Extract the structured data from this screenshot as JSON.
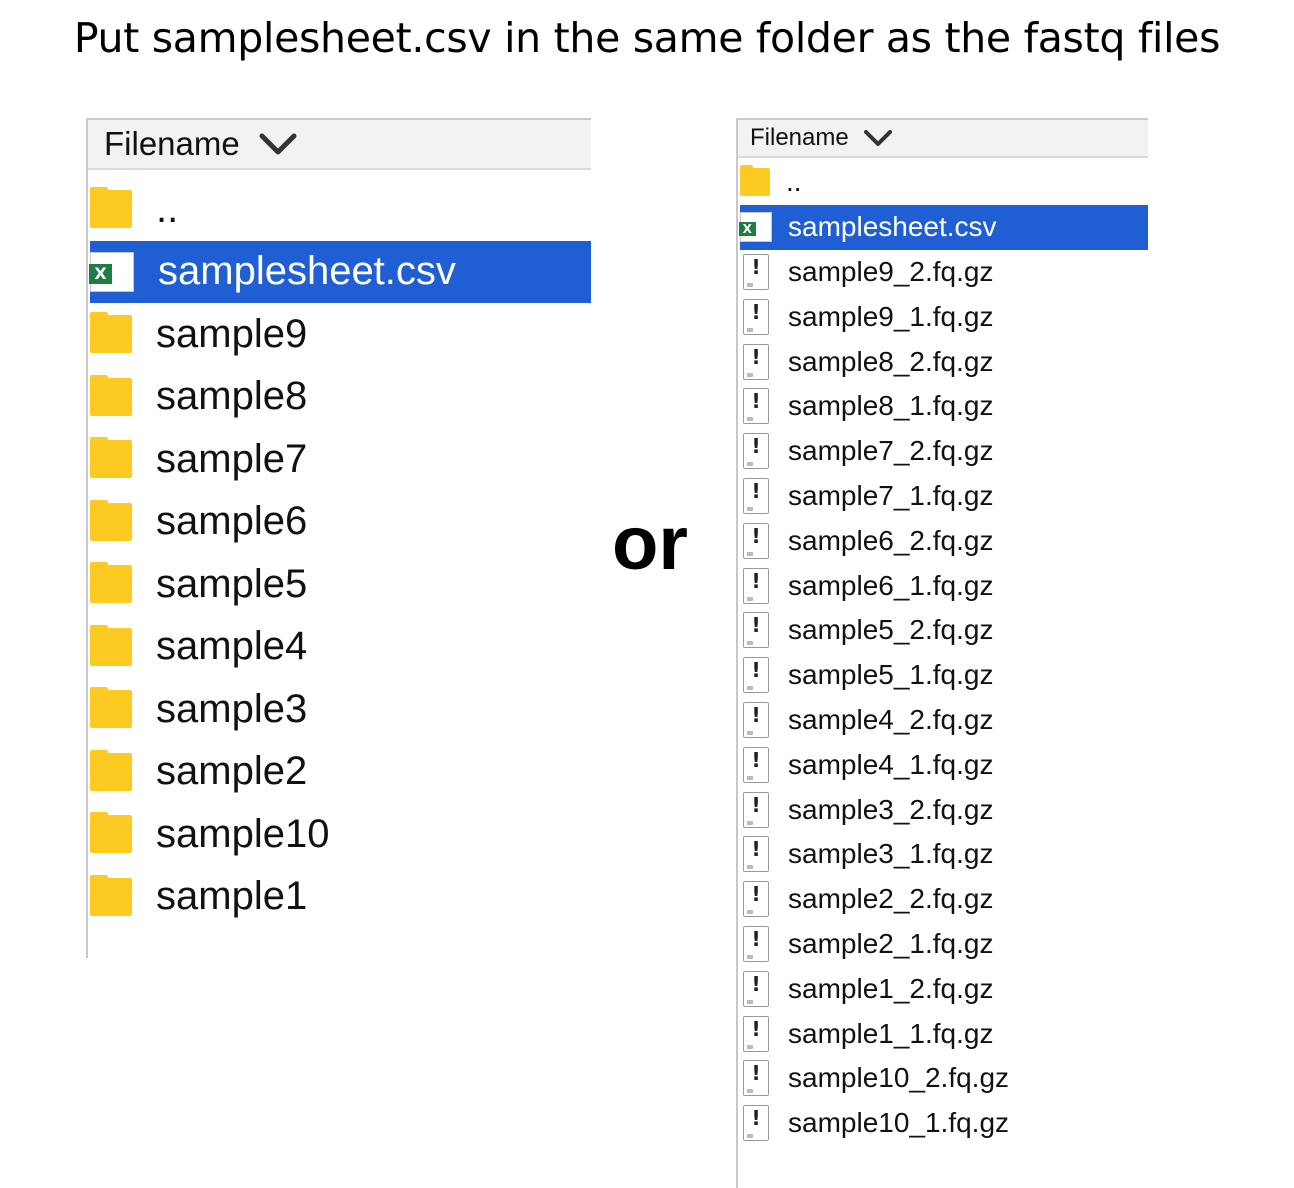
{
  "title": "Put samplesheet.csv in the same folder as the fastq files",
  "separator": "or",
  "left_panel": {
    "header_label": "Filename",
    "header_icon": "chevron-down-icon",
    "files": [
      {
        "name": "..",
        "type": "folder",
        "selected": false
      },
      {
        "name": "samplesheet.csv",
        "type": "excel-csv",
        "selected": true
      },
      {
        "name": "sample9",
        "type": "folder",
        "selected": false
      },
      {
        "name": "sample8",
        "type": "folder",
        "selected": false
      },
      {
        "name": "sample7",
        "type": "folder",
        "selected": false
      },
      {
        "name": "sample6",
        "type": "folder",
        "selected": false
      },
      {
        "name": "sample5",
        "type": "folder",
        "selected": false
      },
      {
        "name": "sample4",
        "type": "folder",
        "selected": false
      },
      {
        "name": "sample3",
        "type": "folder",
        "selected": false
      },
      {
        "name": "sample2",
        "type": "folder",
        "selected": false
      },
      {
        "name": "sample10",
        "type": "folder",
        "selected": false
      },
      {
        "name": "sample1",
        "type": "folder",
        "selected": false
      }
    ]
  },
  "right_panel": {
    "header_label": "Filename",
    "header_icon": "chevron-down-icon",
    "files": [
      {
        "name": "..",
        "type": "folder",
        "selected": false
      },
      {
        "name": "samplesheet.csv",
        "type": "excel-csv",
        "selected": true
      },
      {
        "name": "sample9_2.fq.gz",
        "type": "gz",
        "selected": false
      },
      {
        "name": "sample9_1.fq.gz",
        "type": "gz",
        "selected": false
      },
      {
        "name": "sample8_2.fq.gz",
        "type": "gz",
        "selected": false
      },
      {
        "name": "sample8_1.fq.gz",
        "type": "gz",
        "selected": false
      },
      {
        "name": "sample7_2.fq.gz",
        "type": "gz",
        "selected": false
      },
      {
        "name": "sample7_1.fq.gz",
        "type": "gz",
        "selected": false
      },
      {
        "name": "sample6_2.fq.gz",
        "type": "gz",
        "selected": false
      },
      {
        "name": "sample6_1.fq.gz",
        "type": "gz",
        "selected": false
      },
      {
        "name": "sample5_2.fq.gz",
        "type": "gz",
        "selected": false
      },
      {
        "name": "sample5_1.fq.gz",
        "type": "gz",
        "selected": false
      },
      {
        "name": "sample4_2.fq.gz",
        "type": "gz",
        "selected": false
      },
      {
        "name": "sample4_1.fq.gz",
        "type": "gz",
        "selected": false
      },
      {
        "name": "sample3_2.fq.gz",
        "type": "gz",
        "selected": false
      },
      {
        "name": "sample3_1.fq.gz",
        "type": "gz",
        "selected": false
      },
      {
        "name": "sample2_2.fq.gz",
        "type": "gz",
        "selected": false
      },
      {
        "name": "sample2_1.fq.gz",
        "type": "gz",
        "selected": false
      },
      {
        "name": "sample1_2.fq.gz",
        "type": "gz",
        "selected": false
      },
      {
        "name": "sample1_1.fq.gz",
        "type": "gz",
        "selected": false
      },
      {
        "name": "sample10_2.fq.gz",
        "type": "gz",
        "selected": false
      },
      {
        "name": "sample10_1.fq.gz",
        "type": "gz",
        "selected": false
      }
    ]
  },
  "colors": {
    "selection": "#1f5fd3",
    "folder": "#fcca20",
    "excel": "#1e7c45",
    "header_bg": "#f2f2f2"
  }
}
